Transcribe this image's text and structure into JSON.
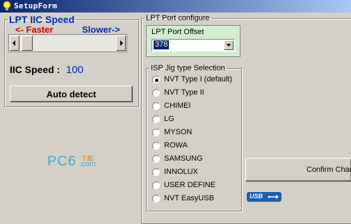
{
  "window": {
    "title": "SetupForm",
    "icon": "bulb-icon"
  },
  "iic": {
    "legend": "LPT IIC Speed",
    "faster": "<- Faster",
    "slower": "Slower->",
    "speed_label": "IIC Speed :",
    "speed_value": "100",
    "auto_detect": "Auto detect"
  },
  "lpt": {
    "legend": "LPT Port configure",
    "offset_label": "LPT Port Offset",
    "offset_value": "378"
  },
  "isp": {
    "legend": "ISP Jig type Selection",
    "options": [
      {
        "label": "NVT Type I (default)",
        "selected": true
      },
      {
        "label": "NVT Type II",
        "selected": false
      },
      {
        "label": "CHIMEI",
        "selected": false
      },
      {
        "label": "LG",
        "selected": false
      },
      {
        "label": "MYSON",
        "selected": false
      },
      {
        "label": "ROWA",
        "selected": false
      },
      {
        "label": "SAMSUNG",
        "selected": false
      },
      {
        "label": "INNOLUX",
        "selected": false
      },
      {
        "label": "USER DEFINE",
        "selected": false
      },
      {
        "label": "NVT EasyUSB",
        "selected": false
      }
    ]
  },
  "confirm_button": "Confirm Chan",
  "watermark": {
    "text": "PC6",
    "sub": "下载",
    "domain": ".com"
  },
  "usb_badge": "USB",
  "colors": {
    "accent": "#002cb0",
    "faster": "#d00000",
    "slower": "#002cb0",
    "title_bg": "#0a246a"
  }
}
